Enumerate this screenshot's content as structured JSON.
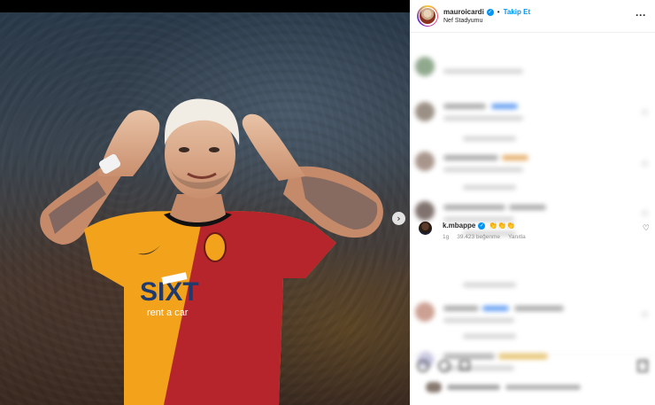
{
  "post": {
    "username": "mauroicardi",
    "follow_label": "Takip Et",
    "location": "Nef Stadyumu",
    "separator": "•",
    "more_icon": "more-horizontal-icon",
    "verified_icon": "verified-badge-icon"
  },
  "photo": {
    "sponsor_text": "SIXT",
    "sponsor_sub": "rent a car",
    "next_icon": "chevron-right-icon"
  },
  "highlighted_comment": {
    "username": "k.mbappe",
    "text": "👏👏👏",
    "time": "1g",
    "likes": "39.423 beğenme",
    "reply_label": "Yanıtla",
    "heart_icon": "heart-icon"
  },
  "colors": {
    "accent": "#0095f6",
    "jersey_red": "#b5252b",
    "jersey_yellow": "#f3a21c"
  }
}
